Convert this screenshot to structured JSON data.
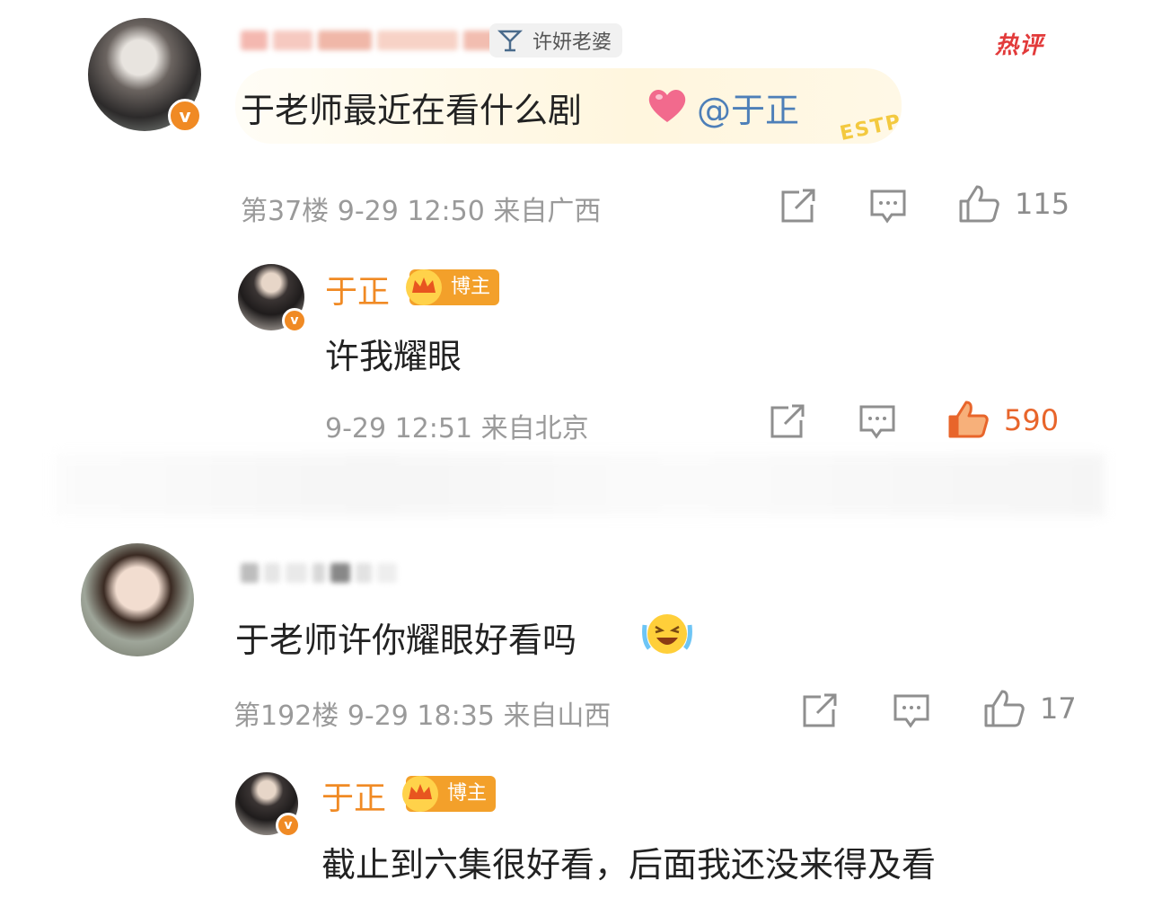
{
  "comments": [
    {
      "tag": "许妍老婆",
      "hot_label": "热评",
      "text": "于老师最近在看什么剧",
      "mention": "@于正",
      "badge": "ESTP",
      "floor": "第37楼",
      "time": "9-29 12:50",
      "location": "来自广西",
      "likes": "115",
      "reply": {
        "name": "于正",
        "role": "博主",
        "text": "许我耀眼",
        "time": "9-29 12:51",
        "location": "来自北京",
        "likes": "590"
      }
    },
    {
      "text": "于老师许你耀眼好看吗",
      "floor": "第192楼",
      "time": "9-29 18:35",
      "location": "来自山西",
      "likes": "17",
      "reply": {
        "name": "于正",
        "role": "博主",
        "text": "截止到六集很好看，后面我还没来得及看"
      }
    }
  ],
  "colors": {
    "accent": "#f08a24",
    "link": "#4d7fb8",
    "hot": "#e23a3a",
    "liked": "#e8652b"
  },
  "icons": [
    "share-icon",
    "comment-icon",
    "like-icon",
    "verified-icon",
    "cocktail-icon",
    "crown-icon",
    "heart-emoji",
    "laugh-cry-emoji"
  ]
}
